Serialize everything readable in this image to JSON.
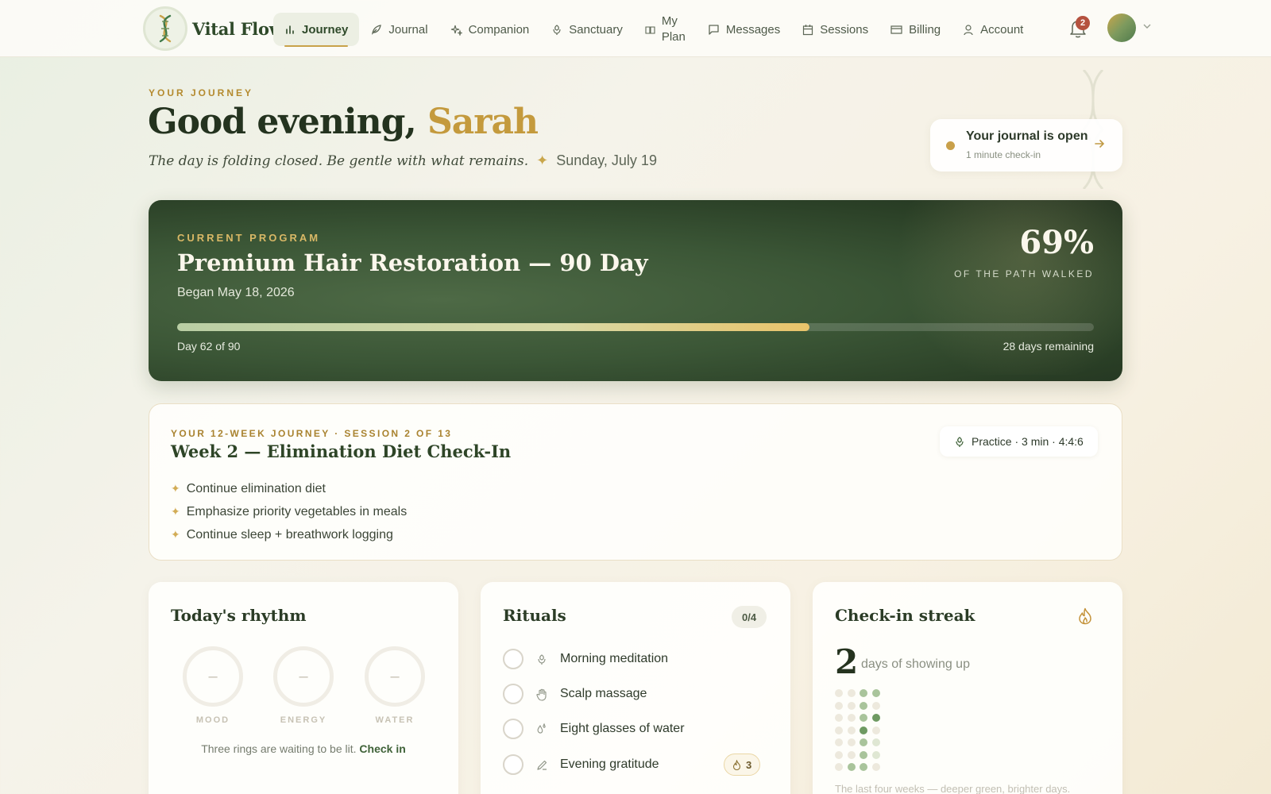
{
  "app": {
    "name": "Vital Flow"
  },
  "nav": {
    "items": [
      {
        "label": "Journey",
        "icon": "bar-chart-icon",
        "active": true
      },
      {
        "label": "Journal",
        "icon": "feather-icon"
      },
      {
        "label": "Companion",
        "icon": "sparkle-icon"
      },
      {
        "label": "Sanctuary",
        "icon": "lotus-icon"
      },
      {
        "label_line1": "My",
        "label_line2": "Plan",
        "icon": "book-icon"
      },
      {
        "label": "Messages",
        "icon": "message-icon"
      },
      {
        "label": "Sessions",
        "icon": "calendar-icon"
      },
      {
        "label": "Billing",
        "icon": "card-icon"
      },
      {
        "label": "Account",
        "icon": "user-icon"
      }
    ],
    "notifications": "2"
  },
  "header": {
    "eyebrow": "YOUR JOURNEY",
    "greeting_prefix": "Good evening, ",
    "greeting_name": "Sarah",
    "quote": "The day is folding closed. Be gentle with what remains.",
    "spark": "✦",
    "date": "Sunday, July 19"
  },
  "journal": {
    "title": "Your journal is open",
    "subtitle": "1 minute check-in"
  },
  "program": {
    "eyebrow": "CURRENT PROGRAM",
    "title": "Premium Hair Restoration — 90 Day",
    "began": "Began May 18, 2026",
    "percent": "69%",
    "percent_label": "OF THE PATH WALKED",
    "progress": 0.69,
    "day_text": "Day 62 of 90",
    "remaining_text": "28 days remaining"
  },
  "session": {
    "eyebrow": "YOUR 12-WEEK JOURNEY · SESSION 2 OF 13",
    "title": "Week 2 — Elimination Diet Check-In",
    "bullets": [
      "Continue elimination diet",
      "Emphasize priority vegetables in meals",
      "Continue sleep + breathwork logging"
    ],
    "bullet_spark": "✦",
    "practice": "Practice · 3 min · 4:4:6"
  },
  "rhythm": {
    "title": "Today's rhythm",
    "rings": [
      {
        "label": "MOOD",
        "value": "–"
      },
      {
        "label": "ENERGY",
        "value": "–"
      },
      {
        "label": "WATER",
        "value": "–"
      }
    ],
    "note": "Three rings are waiting to be lit.",
    "cta": "Check in"
  },
  "rituals": {
    "title": "Rituals",
    "count": "0/4",
    "items": [
      {
        "label": "Morning meditation",
        "icon": "lotus-icon"
      },
      {
        "label": "Scalp massage",
        "icon": "hand-icon"
      },
      {
        "label": "Eight glasses of water",
        "icon": "drops-icon"
      },
      {
        "label": "Evening gratitude",
        "icon": "pen-icon",
        "streak": "3"
      }
    ]
  },
  "streak": {
    "title": "Check-in streak",
    "days": "2",
    "label": "days of showing up",
    "note": "The last four weeks — deeper green, brighter days.",
    "grid": [
      [
        0,
        0,
        2,
        2
      ],
      [
        0,
        0,
        2,
        0
      ],
      [
        0,
        0,
        2,
        3
      ],
      [
        0,
        0,
        3,
        0
      ],
      [
        0,
        0,
        2,
        1
      ],
      [
        0,
        0,
        2,
        1
      ],
      [
        0,
        2,
        2,
        0
      ]
    ],
    "colors": {
      "0": "#ede9dd",
      "1": "#dfe7d3",
      "2": "#a9c49b",
      "3": "#6e9a62"
    }
  }
}
